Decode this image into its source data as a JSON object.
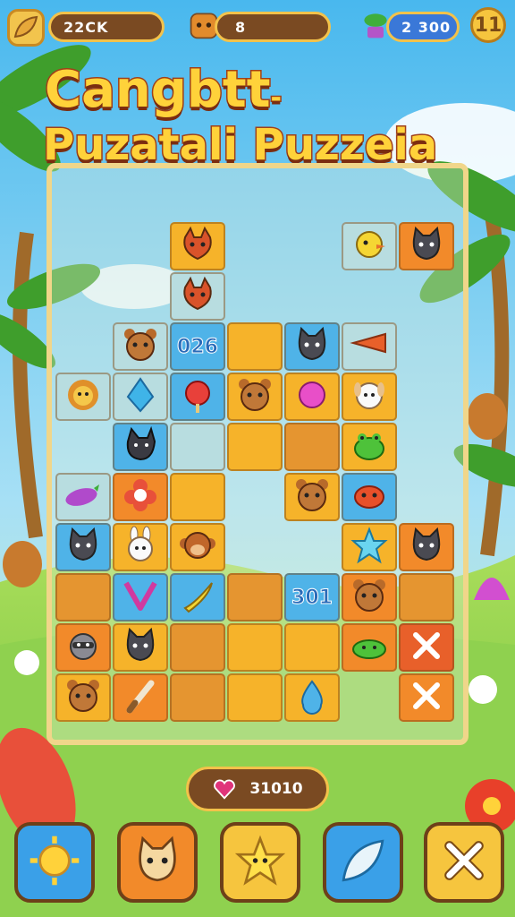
{
  "hud": {
    "coins_value": "22CK",
    "level_value": "8",
    "gems_value": "2 300",
    "pause_label": "11"
  },
  "title": {
    "line1": "Cangbtt",
    "line1_suffix": "-",
    "line2": "Puzatali Puzzeia"
  },
  "board": {
    "tiles": [
      {
        "name": "tile-fox",
        "icon": "fox-icon",
        "color": "#f6b32a",
        "row": 0,
        "col": 2,
        "text": ""
      },
      {
        "name": "tile-yellow-bird",
        "icon": "bird-icon",
        "color": "#b8dde0",
        "row": 0,
        "col": 5,
        "text": ""
      },
      {
        "name": "tile-white-cat",
        "icon": "cat-icon",
        "color": "#f28a2a",
        "row": 0,
        "col": 6,
        "text": ""
      },
      {
        "name": "tile-red-fox",
        "icon": "fox-icon",
        "color": "#b8dde0",
        "row": 1,
        "col": 2,
        "text": ""
      },
      {
        "name": "tile-orange-bear",
        "icon": "bear-icon",
        "color": "#b8dde0",
        "row": 2,
        "col": 1,
        "text": ""
      },
      {
        "name": "tile-text-026",
        "icon": "",
        "color": "#4fb3e8",
        "row": 2,
        "col": 2,
        "text": "026"
      },
      {
        "name": "tile-empty-a",
        "icon": "",
        "color": "#f6b32a",
        "row": 2,
        "col": 3,
        "text": ""
      },
      {
        "name": "tile-black-cat",
        "icon": "cat-icon",
        "color": "#4fb3e8",
        "row": 2,
        "col": 4,
        "text": ""
      },
      {
        "name": "tile-carrot",
        "icon": "carrot-icon",
        "color": "#b8dde0",
        "row": 2,
        "col": 5,
        "text": ""
      },
      {
        "name": "tile-lion",
        "icon": "lion-icon",
        "color": "#b8dde0",
        "row": 3,
        "col": 0,
        "text": ""
      },
      {
        "name": "tile-crystal",
        "icon": "crystal-icon",
        "color": "#b8dde0",
        "row": 3,
        "col": 1,
        "text": ""
      },
      {
        "name": "tile-candy",
        "icon": "candy-icon",
        "color": "#4fb3e8",
        "row": 3,
        "col": 2,
        "text": ""
      },
      {
        "name": "tile-brown-bear",
        "icon": "bear-icon",
        "color": "#f6b32a",
        "row": 3,
        "col": 3,
        "text": ""
      },
      {
        "name": "tile-pink-orb",
        "icon": "orb-icon",
        "color": "#f6b32a",
        "row": 3,
        "col": 4,
        "text": ""
      },
      {
        "name": "tile-white-dog",
        "icon": "dog-icon",
        "color": "#f6b32a",
        "row": 3,
        "col": 5,
        "text": ""
      },
      {
        "name": "tile-black-wolf",
        "icon": "wolf-icon",
        "color": "#4fb3e8",
        "row": 4,
        "col": 1,
        "text": ""
      },
      {
        "name": "tile-empty-b",
        "icon": "",
        "color": "#b8dde0",
        "row": 4,
        "col": 2,
        "text": ""
      },
      {
        "name": "tile-empty-c",
        "icon": "",
        "color": "#f6b32a",
        "row": 4,
        "col": 3,
        "text": ""
      },
      {
        "name": "tile-empty-d",
        "icon": "",
        "color": "#e59530",
        "row": 4,
        "col": 4,
        "text": ""
      },
      {
        "name": "tile-green-frog",
        "icon": "frog-icon",
        "color": "#f6b32a",
        "row": 4,
        "col": 5,
        "text": ""
      },
      {
        "name": "tile-eggplant",
        "icon": "eggplant-icon",
        "color": "#b8dde0",
        "row": 5,
        "col": 0,
        "text": ""
      },
      {
        "name": "tile-red-flower",
        "icon": "flower-icon",
        "color": "#f28a2a",
        "row": 5,
        "col": 1,
        "text": ""
      },
      {
        "name": "tile-empty-e",
        "icon": "",
        "color": "#f6b32a",
        "row": 5,
        "col": 2,
        "text": ""
      },
      {
        "name": "tile-yellow-bear",
        "icon": "bear-icon",
        "color": "#f6b32a",
        "row": 5,
        "col": 4,
        "text": ""
      },
      {
        "name": "tile-red-crab",
        "icon": "crab-icon",
        "color": "#4fb3e8",
        "row": 5,
        "col": 5,
        "text": ""
      },
      {
        "name": "tile-red-cat",
        "icon": "cat-icon",
        "color": "#4fb3e8",
        "row": 6,
        "col": 0,
        "text": ""
      },
      {
        "name": "tile-white-bunny",
        "icon": "bunny-icon",
        "color": "#f6b32a",
        "row": 6,
        "col": 1,
        "text": ""
      },
      {
        "name": "tile-brown-monkey",
        "icon": "monkey-icon",
        "color": "#f6b32a",
        "row": 6,
        "col": 2,
        "text": ""
      },
      {
        "name": "tile-star",
        "icon": "star-icon",
        "color": "#f6b32a",
        "row": 6,
        "col": 5,
        "text": ""
      },
      {
        "name": "tile-grey-cat",
        "icon": "cat-icon",
        "color": "#f28a2a",
        "row": 6,
        "col": 6,
        "text": ""
      },
      {
        "name": "tile-empty-f",
        "icon": "",
        "color": "#e59530",
        "row": 7,
        "col": 0,
        "text": ""
      },
      {
        "name": "tile-heart-v",
        "icon": "heart-icon",
        "color": "#4fb3e8",
        "row": 7,
        "col": 1,
        "text": ""
      },
      {
        "name": "tile-banana",
        "icon": "banana-icon",
        "color": "#4fb3e8",
        "row": 7,
        "col": 2,
        "text": ""
      },
      {
        "name": "tile-empty-g",
        "icon": "",
        "color": "#e59530",
        "row": 7,
        "col": 3,
        "text": ""
      },
      {
        "name": "tile-text-301",
        "icon": "",
        "color": "#4fb3e8",
        "row": 7,
        "col": 4,
        "text": "301"
      },
      {
        "name": "tile-bear-face",
        "icon": "bear-icon",
        "color": "#f28a2a",
        "row": 7,
        "col": 5,
        "text": ""
      },
      {
        "name": "tile-empty-h",
        "icon": "",
        "color": "#e59530",
        "row": 7,
        "col": 6,
        "text": ""
      },
      {
        "name": "tile-raccoon",
        "icon": "raccoon-icon",
        "color": "#f28a2a",
        "row": 8,
        "col": 0,
        "text": ""
      },
      {
        "name": "tile-green-cat",
        "icon": "cat-icon",
        "color": "#f6b32a",
        "row": 8,
        "col": 1,
        "text": ""
      },
      {
        "name": "tile-empty-i",
        "icon": "",
        "color": "#e59530",
        "row": 8,
        "col": 2,
        "text": ""
      },
      {
        "name": "tile-empty-j",
        "icon": "",
        "color": "#f6b32a",
        "row": 8,
        "col": 3,
        "text": ""
      },
      {
        "name": "tile-empty-k",
        "icon": "",
        "color": "#f6b32a",
        "row": 8,
        "col": 4,
        "text": ""
      },
      {
        "name": "tile-green-blob",
        "icon": "blob-icon",
        "color": "#f28a2a",
        "row": 8,
        "col": 5,
        "text": ""
      },
      {
        "name": "tile-x-1",
        "icon": "x-icon",
        "color": "#e8602a",
        "row": 8,
        "col": 6,
        "text": ""
      },
      {
        "name": "tile-black-bear",
        "icon": "bear-icon",
        "color": "#f6b32a",
        "row": 9,
        "col": 0,
        "text": ""
      },
      {
        "name": "tile-brush",
        "icon": "brush-icon",
        "color": "#f28a2a",
        "row": 9,
        "col": 1,
        "text": ""
      },
      {
        "name": "tile-empty-l",
        "icon": "",
        "color": "#e59530",
        "row": 9,
        "col": 2,
        "text": ""
      },
      {
        "name": "tile-empty-m",
        "icon": "",
        "color": "#f6b32a",
        "row": 9,
        "col": 3,
        "text": ""
      },
      {
        "name": "tile-water-drop",
        "icon": "drop-icon",
        "color": "#f6b32a",
        "row": 9,
        "col": 4,
        "text": ""
      },
      {
        "name": "tile-x-2",
        "icon": "x-icon",
        "color": "#f28a2a",
        "row": 9,
        "col": 6,
        "text": ""
      }
    ]
  },
  "moves": {
    "value": "31010"
  },
  "bottom_bar": [
    {
      "name": "sun-button",
      "icon": "sun-icon",
      "color": "#3aa0e8"
    },
    {
      "name": "cat-button",
      "icon": "cat-face-icon",
      "color": "#f28a2a"
    },
    {
      "name": "star-creature-button",
      "icon": "star-creature-icon",
      "color": "#f6c53e"
    },
    {
      "name": "leaf-button",
      "icon": "leaf-icon",
      "color": "#3aa0e8"
    },
    {
      "name": "close-button",
      "icon": "x-icon",
      "color": "#f6c53e"
    }
  ],
  "colors": {
    "sky": "#5fc3f0",
    "grass": "#8fd14f",
    "board_frame": "#f0d68a",
    "title_fill": "#ffd23a",
    "title_stroke": "#a0401a"
  }
}
